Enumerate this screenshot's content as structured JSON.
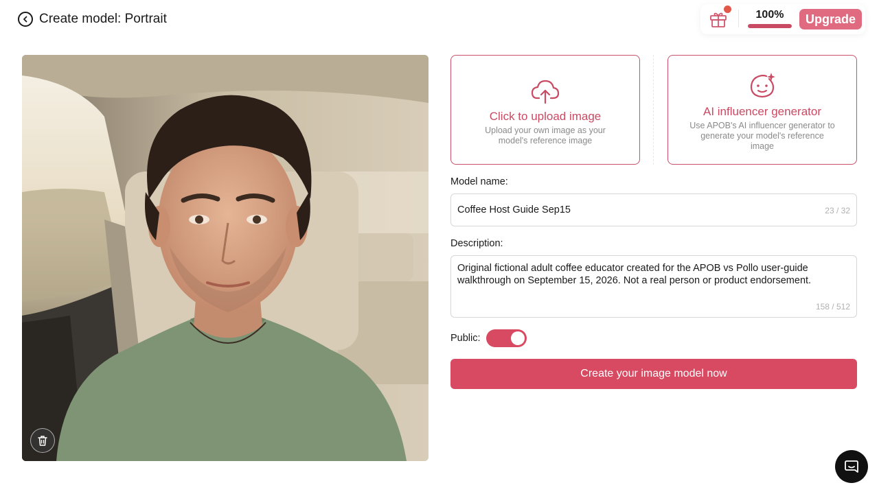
{
  "header": {
    "title": "Create model: Portrait",
    "credits_percent": "100%",
    "credits_fill": 1.0,
    "upgrade_label": "Upgrade"
  },
  "upload_card": {
    "title": "Click to upload image",
    "description": "Upload your own image as your model's reference image"
  },
  "ai_card": {
    "title": "AI influencer generator",
    "description": "Use APOB's AI influencer generator to generate your model's reference image"
  },
  "form": {
    "name_label": "Model name:",
    "name_value": "Coffee Host Guide Sep15",
    "name_counter": "23 / 32",
    "description_label": "Description:",
    "description_value": "Original fictional adult coffee educator created for the APOB vs Pollo user-guide walkthrough on September 15, 2026. Not a real person or product endorsement.",
    "description_counter": "158 / 512",
    "public_label": "Public:",
    "public_enabled": true,
    "submit_label": "Create your image model now"
  },
  "colors": {
    "accent": "#d84a62",
    "upgrade": "#e06b80",
    "notification": "#e2584b"
  },
  "icons": {
    "back": "back-arrow-circle-icon",
    "gift": "gift-icon",
    "upload": "cloud-upload-icon",
    "ai": "sparkle-face-icon",
    "delete": "trash-icon",
    "chat": "chat-icon"
  }
}
